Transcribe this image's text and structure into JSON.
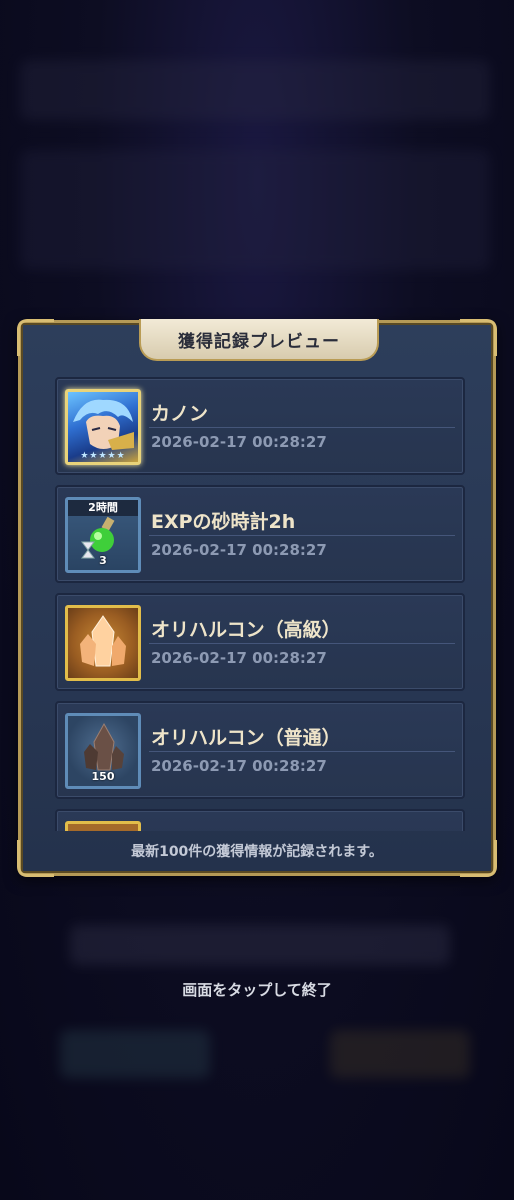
{
  "panel": {
    "title": "獲得記録プレビュー",
    "footer_note": "最新100件の獲得情報が記録されます。"
  },
  "items": [
    {
      "name": "カノン",
      "date": "2026-02-17 00:28:27",
      "icon": "character-portrait-icon",
      "stars": "★★★★★"
    },
    {
      "name": "EXPの砂時計2h",
      "date": "2026-02-17 00:28:27",
      "icon": "hourglass-potion-icon",
      "badge": "2時間",
      "count": "3"
    },
    {
      "name": "オリハルコン（高級）",
      "date": "2026-02-17 00:28:27",
      "icon": "orichalcum-crystal-icon"
    },
    {
      "name": "オリハルコン（普通）",
      "date": "2026-02-17 00:28:27",
      "icon": "dark-crystal-icon",
      "count": "150"
    }
  ],
  "tap_hint": "画面をタップして終了",
  "colors": {
    "accent_gold": "#d8bd73",
    "panel_bg": "#2d3e5b",
    "title_tab": "#f2ead7"
  }
}
